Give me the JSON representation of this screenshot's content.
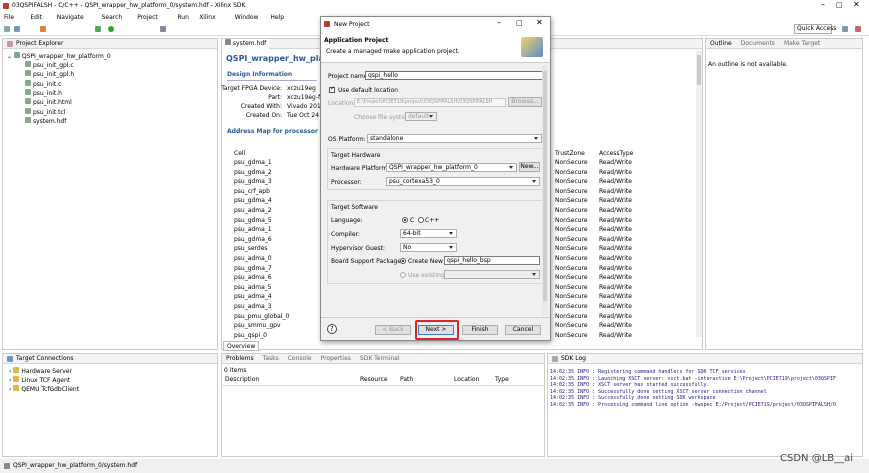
{
  "window": {
    "title": "03QSPIFALSH - C/C++ - QSPI_wrapper_hw_platform_0/system.hdf - Xilinx SDK"
  },
  "menu": [
    "File",
    "Edit",
    "Navigate",
    "Search",
    "Project",
    "Run",
    "Xilinx",
    "Window",
    "Help"
  ],
  "toolbar": {
    "quick_access": "Quick Access"
  },
  "explorer": {
    "title": "Project Explorer",
    "root": "QSPI_wrapper_hw_platform_0",
    "files": [
      "psu_init_gpl.c",
      "psu_init_gpl.h",
      "psu_init.c",
      "psu_init.h",
      "psu_init.html",
      "psu_init.tcl",
      "system.hdf"
    ]
  },
  "editor": {
    "tab": "system.hdf",
    "heading": "QSPI_wrapper_hw_platform",
    "design_info": "Design Information",
    "info_rows": [
      {
        "k": "Target FPGA Device:",
        "v": "xczu19eg"
      },
      {
        "k": "Part:",
        "v": "xczu19eg-ffv"
      },
      {
        "k": "Created With:",
        "v": "Vivado 2018"
      },
      {
        "k": "Created On:",
        "v": "Tue Oct 24 1"
      }
    ],
    "address_map": "Address Map for processor psu_co",
    "col_cell": "Cell",
    "col_trust": "TrustZone",
    "col_access": "AccessType",
    "cells": [
      "psu_gdma_1",
      "psu_gdma_2",
      "psu_gdma_3",
      "psu_crf_apb",
      "psu_gdma_4",
      "psu_adma_2",
      "psu_gdma_5",
      "psu_adma_1",
      "psu_gdma_6",
      "psu_serdes",
      "psu_adma_0",
      "psu_gdma_7",
      "psu_adma_6",
      "psu_adma_5",
      "psu_adma_4",
      "psu_adma_3",
      "psu_pmu_global_0",
      "psu_smmu_gpv",
      "psu_qspi_0"
    ],
    "trust": "NonSecure",
    "access": "Read/Write",
    "overview_tab": "Overview"
  },
  "outline": {
    "tabs": [
      "Outline",
      "Documents",
      "Make Target"
    ],
    "message": "An outline is not available."
  },
  "connections": {
    "title": "Target Connections",
    "items": [
      "Hardware Server",
      "Linux TCF Agent",
      "QEMU TcfGdbClient"
    ]
  },
  "problems": {
    "tabs": [
      "Problems",
      "Tasks",
      "Console",
      "Properties",
      "SDK Terminal"
    ],
    "count": "0 items",
    "columns": [
      "Description",
      "Resource",
      "Path",
      "Location",
      "Type"
    ]
  },
  "sdklog": {
    "title": "SDK Log",
    "lines": [
      "14:02:35 INFO   : Registering command handlers for SDK TCF services",
      "14:02:35 INFO   : Launching XSCT server: xsct.bat -interactive E:\\Project\\PCIE719\\project\\03QSPIF",
      "14:02:35 INFO   : XSCT server has started successfully.",
      "14:02:35 INFO   : Successfully done setting XSCT server connection channel",
      "14:02:35 INFO   : Successfully done setting SDK workspace",
      "14:02:35 INFO   : Processing command line option -hwspec E:/Project/PCIE719/project/03QSPIFALSH/0"
    ]
  },
  "status": {
    "path": "QSPI_wrapper_hw_platform_0/system.hdf"
  },
  "dialog": {
    "title": "New Project",
    "heading": "Application Project",
    "subtitle": "Create a managed make application project.",
    "project_name_label": "Project name:",
    "project_name": "qspi_hello",
    "use_default": "Use default location",
    "location_label": "Location:",
    "location": "E:\\Project\\PCIE719\\project\\03QSPIFALSH\\03QSPIFALSH",
    "browse": "Browse...",
    "choose_fs": "Choose file system:",
    "fs_value": "default",
    "os_label": "OS Platform:",
    "os": "standalone",
    "target_hw": "Target Hardware",
    "hw_platform_label": "Hardware Platform:",
    "hw_platform": "QSPI_wrapper_hw_platform_0",
    "new_btn": "New...",
    "processor_label": "Processor:",
    "processor": "psu_cortexa53_0",
    "target_sw": "Target Software",
    "language_label": "Language:",
    "lang_c": "C",
    "lang_cpp": "C++",
    "compiler_label": "Compiler:",
    "compiler": "64-bit",
    "hypervisor_label": "Hypervisor Guest:",
    "hypervisor": "No",
    "bsp_label": "Board Support Package:",
    "create_new": "Create New",
    "bsp": "qspi_hello_bsp",
    "use_existing": "Use existing",
    "back": "< Back",
    "next": "Next >",
    "finish": "Finish",
    "cancel": "Cancel",
    "help": "?"
  },
  "watermark": "CSDN @LB__ai"
}
